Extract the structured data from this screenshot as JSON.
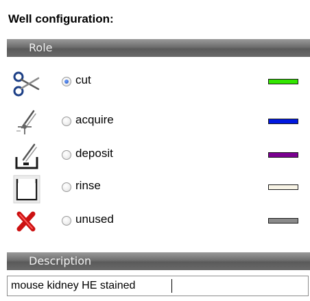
{
  "title": "Well configuration:",
  "sections": {
    "role": "Role",
    "description": "Description"
  },
  "roles": [
    {
      "label": "cut",
      "checked": true,
      "color": "#33e600",
      "icon": "scissors-icon"
    },
    {
      "label": "acquire",
      "checked": false,
      "color": "#0018e0",
      "icon": "acquire-tool-icon"
    },
    {
      "label": "deposit",
      "checked": false,
      "color": "#7a0090",
      "icon": "deposit-tool-icon"
    },
    {
      "label": "rinse",
      "checked": false,
      "color": "#f8f4e6",
      "icon": "rinse-container-icon"
    },
    {
      "label": "unused",
      "checked": false,
      "color": "#8a8a8a",
      "icon": "red-x-icon"
    }
  ],
  "description": {
    "value": "mouse kidney HE stained"
  }
}
